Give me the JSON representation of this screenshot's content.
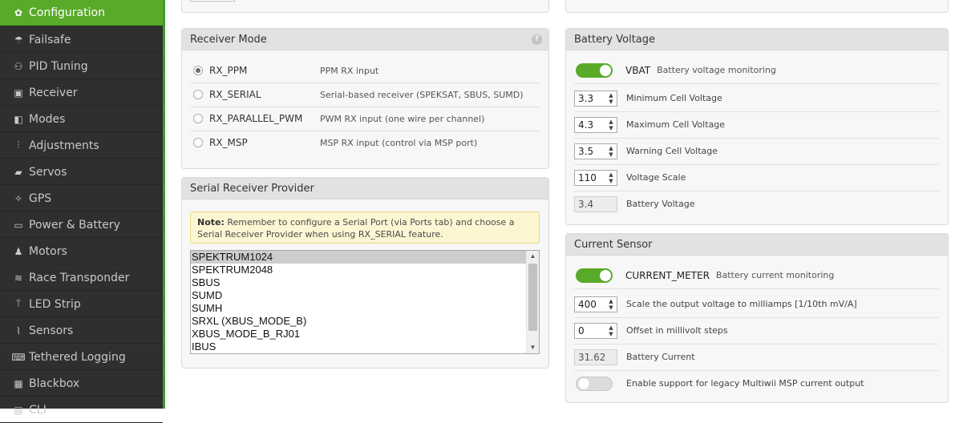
{
  "sidebar": {
    "items": [
      {
        "label": "Configuration",
        "icon": "gear-icon",
        "active": true
      },
      {
        "label": "Failsafe",
        "icon": "parachute-icon"
      },
      {
        "label": "PID Tuning",
        "icon": "hierarchy-icon"
      },
      {
        "label": "Receiver",
        "icon": "receiver-icon"
      },
      {
        "label": "Modes",
        "icon": "switches-icon"
      },
      {
        "label": "Adjustments",
        "icon": "sliders-icon"
      },
      {
        "label": "Servos",
        "icon": "servo-icon"
      },
      {
        "label": "GPS",
        "icon": "satellite-icon"
      },
      {
        "label": "Power & Battery",
        "icon": "battery-icon"
      },
      {
        "label": "Motors",
        "icon": "motor-icon"
      },
      {
        "label": "Race Transponder",
        "icon": "transponder-icon"
      },
      {
        "label": "LED Strip",
        "icon": "led-icon"
      },
      {
        "label": "Sensors",
        "icon": "pulse-icon"
      },
      {
        "label": "Tethered Logging",
        "icon": "keyboard-icon"
      },
      {
        "label": "Blackbox",
        "icon": "blackbox-icon"
      },
      {
        "label": "CLI",
        "icon": "terminal-icon"
      }
    ]
  },
  "receiver_mode": {
    "title": "Receiver Mode",
    "help": "?",
    "options": [
      {
        "name": "RX_PPM",
        "desc": "PPM RX input",
        "checked": true
      },
      {
        "name": "RX_SERIAL",
        "desc": "Serial-based receiver (SPEKSAT, SBUS, SUMD)",
        "checked": false
      },
      {
        "name": "RX_PARALLEL_PWM",
        "desc": "PWM RX input (one wire per channel)",
        "checked": false
      },
      {
        "name": "RX_MSP",
        "desc": "MSP RX input (control via MSP port)",
        "checked": false
      }
    ]
  },
  "serial_provider": {
    "title": "Serial Receiver Provider",
    "note_label": "Note:",
    "note_text": "Remember to configure a Serial Port (via Ports tab) and choose a Serial Receiver Provider when using RX_SERIAL feature.",
    "options": [
      "SPEKTRUM1024",
      "SPEKTRUM2048",
      "SBUS",
      "SUMD",
      "SUMH",
      "SRXL (XBUS_MODE_B)",
      "XBUS_MODE_B_RJ01",
      "IBUS"
    ],
    "selected": "SPEKTRUM1024",
    "scroll_up": "▲",
    "scroll_down": "▼"
  },
  "battery": {
    "title": "Battery Voltage",
    "toggle_label": "VBAT",
    "toggle_desc": "Battery voltage monitoring",
    "toggle_on": true,
    "min_cell": {
      "value": "3.3",
      "label": "Minimum Cell Voltage"
    },
    "max_cell": {
      "value": "4.3",
      "label": "Maximum Cell Voltage"
    },
    "warn_cell": {
      "value": "3.5",
      "label": "Warning Cell Voltage"
    },
    "scale": {
      "value": "110",
      "label": "Voltage Scale"
    },
    "voltage": {
      "value": "3.4",
      "label": "Battery Voltage"
    }
  },
  "current": {
    "title": "Current Sensor",
    "toggle_label": "CURRENT_METER",
    "toggle_desc": "Battery current monitoring",
    "toggle_on": true,
    "scale": {
      "value": "400",
      "label": "Scale the output voltage to milliamps [1/10th mV/A]"
    },
    "offset": {
      "value": "0",
      "label": "Offset in millivolt steps"
    },
    "current": {
      "value": "31.62",
      "label": "Battery Current"
    },
    "legacy": {
      "label": "Enable support for legacy Multiwii MSP current output",
      "on": false
    }
  },
  "spinner": {
    "up": "▲",
    "down": "▼"
  },
  "colors": {
    "accent": "#59aa29",
    "sidebar": "#2f2f2f",
    "note_bg": "#fdf6d3"
  }
}
